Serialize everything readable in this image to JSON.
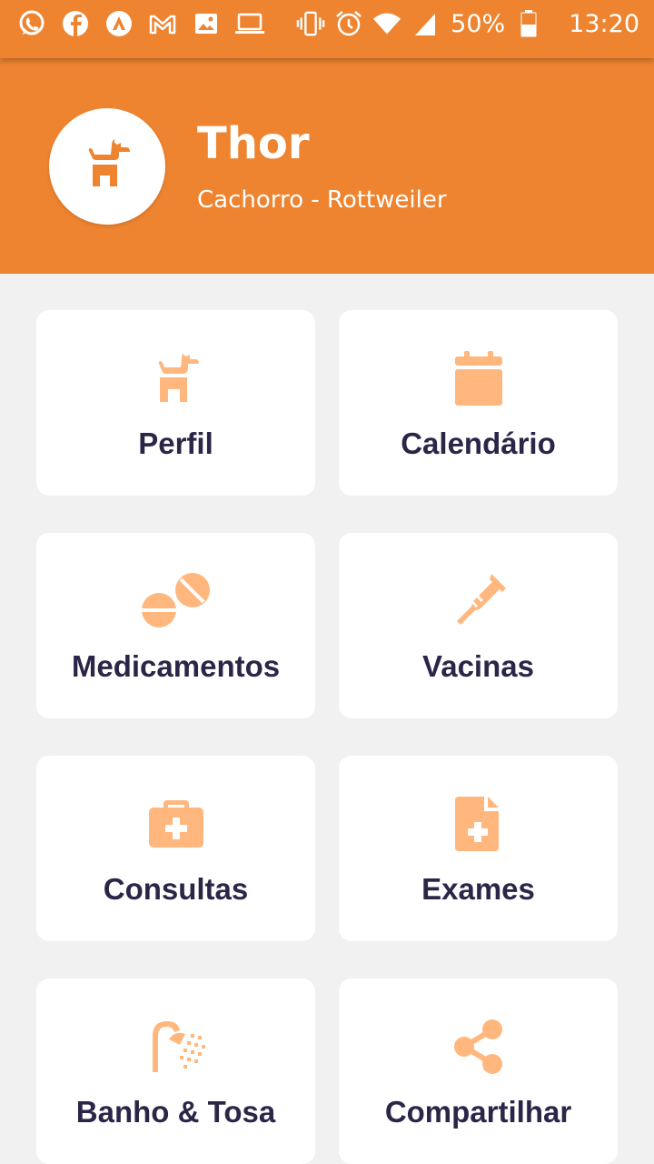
{
  "status_bar": {
    "left_icons": [
      "whatsapp-icon",
      "facebook-icon",
      "app-a-icon",
      "gmail-icon",
      "gallery-icon",
      "laptop-icon"
    ],
    "right_icons": [
      "vibrate-icon",
      "alarm-icon",
      "wifi-icon",
      "signal-icon"
    ],
    "battery": "50%",
    "time": "13:20"
  },
  "header": {
    "pet_name": "Thor",
    "pet_subtitle": "Cachorro - Rottweiler",
    "avatar_icon": "dog-icon"
  },
  "colors": {
    "primary": "#ee8430",
    "icon": "#ffb77e",
    "label": "#2b2648",
    "background": "#f1f1f1"
  },
  "menu": {
    "items": [
      {
        "label": "Perfil",
        "icon": "dog-icon"
      },
      {
        "label": "Calendário",
        "icon": "calendar-icon"
      },
      {
        "label": "Medicamentos",
        "icon": "pills-icon"
      },
      {
        "label": "Vacinas",
        "icon": "syringe-icon"
      },
      {
        "label": "Consultas",
        "icon": "medical-kit-icon"
      },
      {
        "label": "Exames",
        "icon": "medical-file-icon"
      },
      {
        "label": "Banho & Tosa",
        "icon": "shower-icon"
      },
      {
        "label": "Compartilhar",
        "icon": "share-icon"
      }
    ]
  }
}
